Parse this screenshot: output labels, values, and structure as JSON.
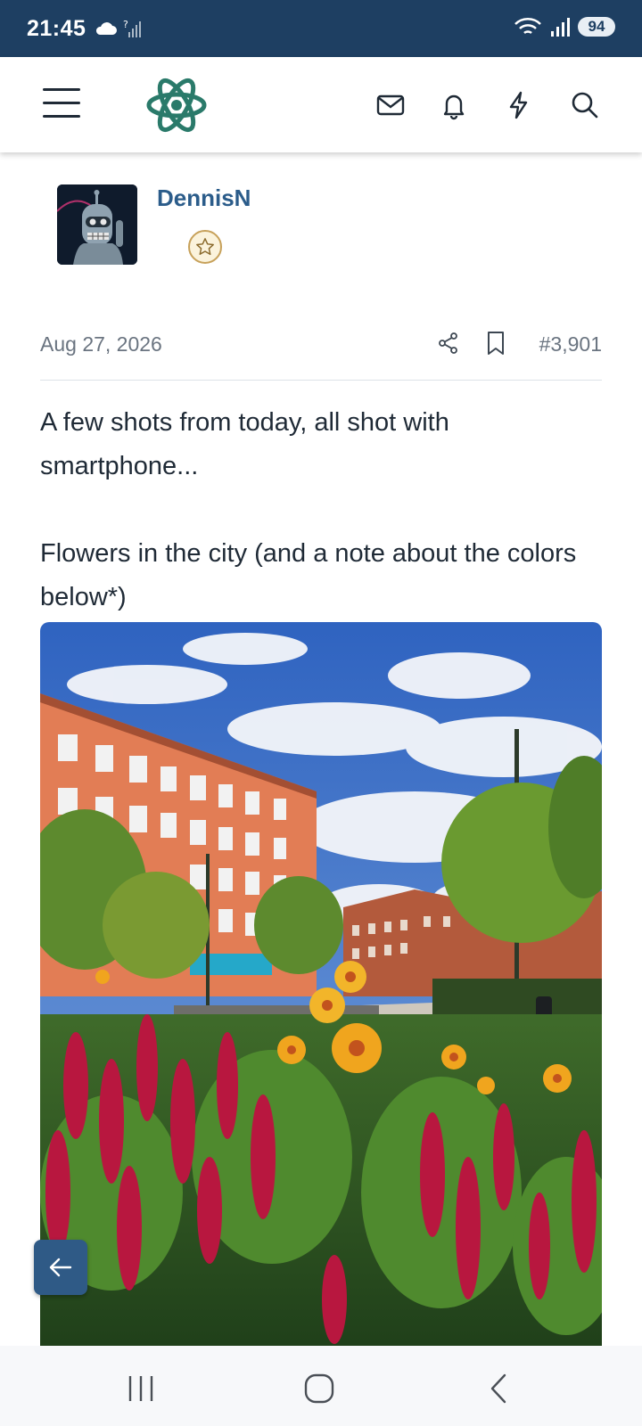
{
  "status_bar": {
    "time": "21:45",
    "battery": "94",
    "icons": [
      "cloud-icon",
      "no-sim-signal-icon",
      "wifi-icon",
      "signal-icon",
      "battery-icon"
    ]
  },
  "header": {
    "icons": [
      "menu-icon",
      "atom-logo-icon",
      "mail-icon",
      "bell-icon",
      "lightning-icon",
      "search-icon"
    ],
    "brand_color": "#2a7a6a"
  },
  "post": {
    "author": "DennisN",
    "date": "Aug 27, 2026",
    "number": "#3,901",
    "text_1": "A few shots from today, all shot with smartphone...",
    "text_2": "Flowers in the city (and a note about the colors below*)"
  },
  "colors": {
    "status_bar_bg": "#1e3f62",
    "username": "#2b5c8a",
    "float_button": "#2f5a86"
  },
  "nav": {
    "icons": [
      "recent-apps-icon",
      "home-icon",
      "back-icon"
    ]
  }
}
